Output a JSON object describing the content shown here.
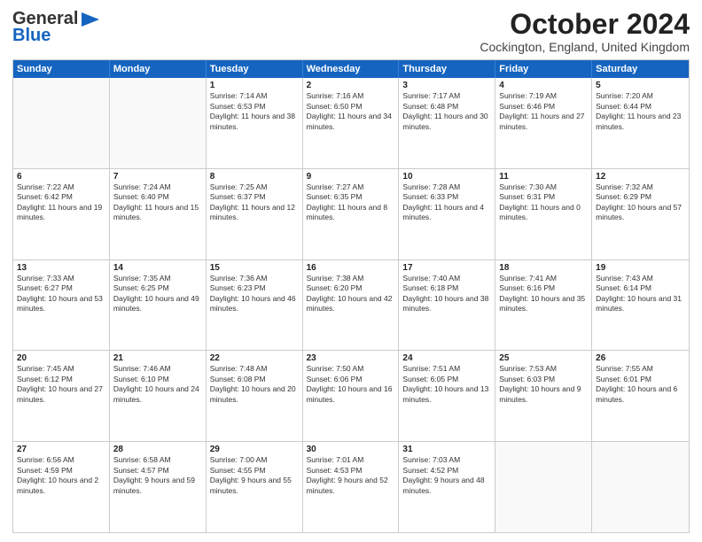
{
  "header": {
    "logo_general": "General",
    "logo_blue": "Blue",
    "month_title": "October 2024",
    "location": "Cockington, England, United Kingdom"
  },
  "days_of_week": [
    "Sunday",
    "Monday",
    "Tuesday",
    "Wednesday",
    "Thursday",
    "Friday",
    "Saturday"
  ],
  "weeks": [
    [
      {
        "day": "",
        "text": "",
        "empty": true
      },
      {
        "day": "",
        "text": "",
        "empty": true
      },
      {
        "day": "1",
        "text": "Sunrise: 7:14 AM\nSunset: 6:53 PM\nDaylight: 11 hours and 38 minutes."
      },
      {
        "day": "2",
        "text": "Sunrise: 7:16 AM\nSunset: 6:50 PM\nDaylight: 11 hours and 34 minutes."
      },
      {
        "day": "3",
        "text": "Sunrise: 7:17 AM\nSunset: 6:48 PM\nDaylight: 11 hours and 30 minutes."
      },
      {
        "day": "4",
        "text": "Sunrise: 7:19 AM\nSunset: 6:46 PM\nDaylight: 11 hours and 27 minutes."
      },
      {
        "day": "5",
        "text": "Sunrise: 7:20 AM\nSunset: 6:44 PM\nDaylight: 11 hours and 23 minutes."
      }
    ],
    [
      {
        "day": "6",
        "text": "Sunrise: 7:22 AM\nSunset: 6:42 PM\nDaylight: 11 hours and 19 minutes."
      },
      {
        "day": "7",
        "text": "Sunrise: 7:24 AM\nSunset: 6:40 PM\nDaylight: 11 hours and 15 minutes."
      },
      {
        "day": "8",
        "text": "Sunrise: 7:25 AM\nSunset: 6:37 PM\nDaylight: 11 hours and 12 minutes."
      },
      {
        "day": "9",
        "text": "Sunrise: 7:27 AM\nSunset: 6:35 PM\nDaylight: 11 hours and 8 minutes."
      },
      {
        "day": "10",
        "text": "Sunrise: 7:28 AM\nSunset: 6:33 PM\nDaylight: 11 hours and 4 minutes."
      },
      {
        "day": "11",
        "text": "Sunrise: 7:30 AM\nSunset: 6:31 PM\nDaylight: 11 hours and 0 minutes."
      },
      {
        "day": "12",
        "text": "Sunrise: 7:32 AM\nSunset: 6:29 PM\nDaylight: 10 hours and 57 minutes."
      }
    ],
    [
      {
        "day": "13",
        "text": "Sunrise: 7:33 AM\nSunset: 6:27 PM\nDaylight: 10 hours and 53 minutes."
      },
      {
        "day": "14",
        "text": "Sunrise: 7:35 AM\nSunset: 6:25 PM\nDaylight: 10 hours and 49 minutes."
      },
      {
        "day": "15",
        "text": "Sunrise: 7:36 AM\nSunset: 6:23 PM\nDaylight: 10 hours and 46 minutes."
      },
      {
        "day": "16",
        "text": "Sunrise: 7:38 AM\nSunset: 6:20 PM\nDaylight: 10 hours and 42 minutes."
      },
      {
        "day": "17",
        "text": "Sunrise: 7:40 AM\nSunset: 6:18 PM\nDaylight: 10 hours and 38 minutes."
      },
      {
        "day": "18",
        "text": "Sunrise: 7:41 AM\nSunset: 6:16 PM\nDaylight: 10 hours and 35 minutes."
      },
      {
        "day": "19",
        "text": "Sunrise: 7:43 AM\nSunset: 6:14 PM\nDaylight: 10 hours and 31 minutes."
      }
    ],
    [
      {
        "day": "20",
        "text": "Sunrise: 7:45 AM\nSunset: 6:12 PM\nDaylight: 10 hours and 27 minutes."
      },
      {
        "day": "21",
        "text": "Sunrise: 7:46 AM\nSunset: 6:10 PM\nDaylight: 10 hours and 24 minutes."
      },
      {
        "day": "22",
        "text": "Sunrise: 7:48 AM\nSunset: 6:08 PM\nDaylight: 10 hours and 20 minutes."
      },
      {
        "day": "23",
        "text": "Sunrise: 7:50 AM\nSunset: 6:06 PM\nDaylight: 10 hours and 16 minutes."
      },
      {
        "day": "24",
        "text": "Sunrise: 7:51 AM\nSunset: 6:05 PM\nDaylight: 10 hours and 13 minutes."
      },
      {
        "day": "25",
        "text": "Sunrise: 7:53 AM\nSunset: 6:03 PM\nDaylight: 10 hours and 9 minutes."
      },
      {
        "day": "26",
        "text": "Sunrise: 7:55 AM\nSunset: 6:01 PM\nDaylight: 10 hours and 6 minutes."
      }
    ],
    [
      {
        "day": "27",
        "text": "Sunrise: 6:56 AM\nSunset: 4:59 PM\nDaylight: 10 hours and 2 minutes."
      },
      {
        "day": "28",
        "text": "Sunrise: 6:58 AM\nSunset: 4:57 PM\nDaylight: 9 hours and 59 minutes."
      },
      {
        "day": "29",
        "text": "Sunrise: 7:00 AM\nSunset: 4:55 PM\nDaylight: 9 hours and 55 minutes."
      },
      {
        "day": "30",
        "text": "Sunrise: 7:01 AM\nSunset: 4:53 PM\nDaylight: 9 hours and 52 minutes."
      },
      {
        "day": "31",
        "text": "Sunrise: 7:03 AM\nSunset: 4:52 PM\nDaylight: 9 hours and 48 minutes."
      },
      {
        "day": "",
        "text": "",
        "empty": true
      },
      {
        "day": "",
        "text": "",
        "empty": true
      }
    ]
  ]
}
